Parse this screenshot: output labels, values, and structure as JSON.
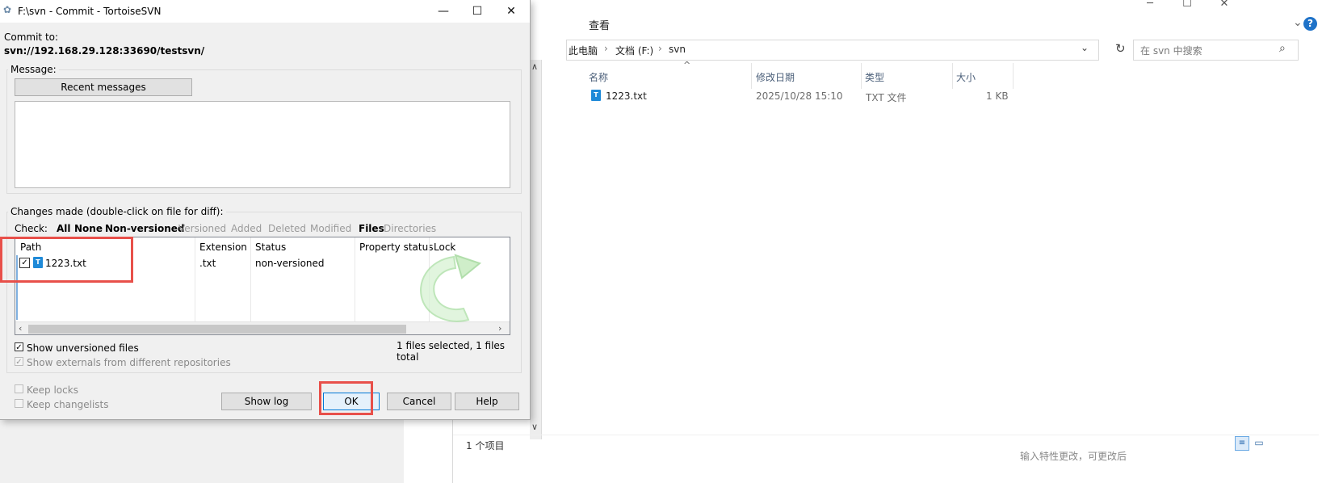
{
  "dialog": {
    "title": "F:\\svn - Commit - TortoiseSVN",
    "commit_to_label": "Commit to:",
    "commit_url": "svn://192.168.29.128:33690/testsvn/",
    "message_label": "Message:",
    "recent_messages_button": "Recent messages",
    "message_text": "",
    "changes_label": "Changes made (double-click on file for diff):",
    "check": {
      "label": "Check:",
      "all": "All",
      "none": "None",
      "nonversioned": "Non-versioned",
      "versioned": "Versioned",
      "added": "Added",
      "deleted": "Deleted",
      "modified": "Modified",
      "files": "Files",
      "directories": "Directories"
    },
    "columns": {
      "path": "Path",
      "extension": "Extension",
      "status": "Status",
      "property_status": "Property status",
      "lock": "Lock"
    },
    "rows": [
      {
        "path": "1223.txt",
        "extension": ".txt",
        "status": "non-versioned",
        "checked": true,
        "icon": "txt-file-icon"
      }
    ],
    "show_unversioned": "Show unversioned files",
    "show_externals": "Show externals from different repositories",
    "selection_summary": "1 files selected, 1 files total",
    "keep_locks": "Keep locks",
    "keep_changelists": "Keep changelists",
    "buttons": {
      "show_log": "Show log",
      "ok": "OK",
      "cancel": "Cancel",
      "help": "Help"
    },
    "annotation_color": "#e8504a"
  },
  "explorer": {
    "ribbon_view": "查看",
    "breadcrumb": [
      "此电脑",
      "文档 (F:)",
      "svn"
    ],
    "search_placeholder": "在 svn 中搜索",
    "columns": {
      "name": "名称",
      "modified": "修改日期",
      "type": "类型",
      "size": "大小"
    },
    "files": [
      {
        "name": "1223.txt",
        "modified": "2025/10/28 15:10",
        "type": "TXT 文件",
        "size": "1 KB"
      }
    ],
    "status_count": "1 个项目",
    "fragment_text": "输入特性更改，可更改后"
  }
}
